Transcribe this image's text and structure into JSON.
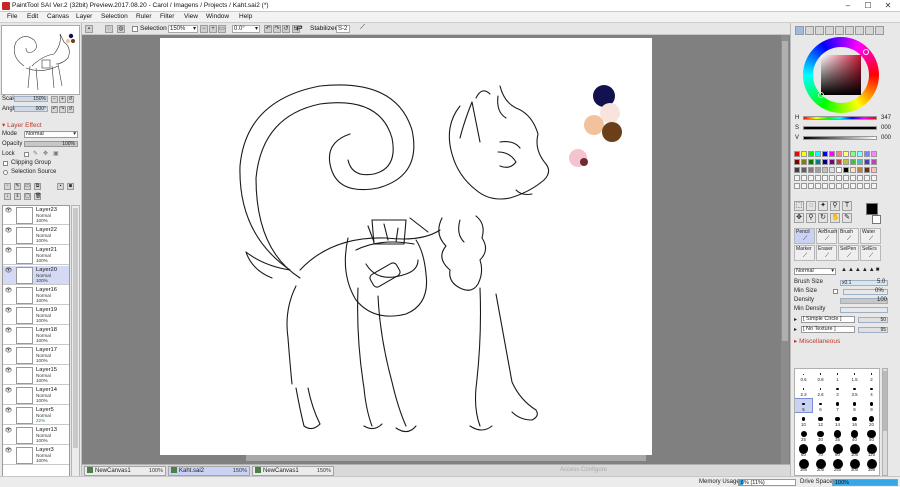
{
  "window": {
    "title": "PaintTool SAI Ver.2 (32bit) Preview.2017.08.20 - Carol / Imagens / Projects / Kaht.sai2 (*)"
  },
  "menu": [
    "File",
    "Edit",
    "Canvas",
    "Layer",
    "Selection",
    "Ruler",
    "Filter",
    "View",
    "Window",
    "Help"
  ],
  "toolbar": {
    "selection_label": "Selection",
    "zoom": "150%",
    "angle": "0.0°",
    "stabilizer_label": "Stabilizer",
    "stabilizer_value": "S-2"
  },
  "navigator": {
    "scale_label": "Scale",
    "scale_value": "150%",
    "angle_label": "Angle",
    "angle_value": "000°"
  },
  "layer_effect": {
    "title": "Layer Effect",
    "mode_label": "Mode",
    "mode_value": "Normal",
    "opacity_label": "Opacity",
    "opacity_value": "100%",
    "lock_label": "Lock",
    "clipping_group": "Clipping Group",
    "selection_source": "Selection Source"
  },
  "layers": [
    {
      "name": "Layer23",
      "mode": "Normal",
      "opacity": "100%",
      "selected": false
    },
    {
      "name": "Layer22",
      "mode": "Normal",
      "opacity": "100%",
      "selected": false
    },
    {
      "name": "Layer21",
      "mode": "Normal",
      "opacity": "100%",
      "selected": false
    },
    {
      "name": "Layer20",
      "mode": "Normal",
      "opacity": "100%",
      "selected": true
    },
    {
      "name": "Layer16",
      "mode": "Normal",
      "opacity": "100%",
      "selected": false
    },
    {
      "name": "Layer19",
      "mode": "Normal",
      "opacity": "100%",
      "selected": false
    },
    {
      "name": "Layer18",
      "mode": "Normal",
      "opacity": "100%",
      "selected": false
    },
    {
      "name": "Layer17",
      "mode": "Normal",
      "opacity": "100%",
      "selected": false
    },
    {
      "name": "Layer15",
      "mode": "Normal",
      "opacity": "100%",
      "selected": false
    },
    {
      "name": "Layer14",
      "mode": "Normal",
      "opacity": "100%",
      "selected": false
    },
    {
      "name": "Layer5",
      "mode": "Normal",
      "opacity": "22%",
      "selected": false
    },
    {
      "name": "Layer13",
      "mode": "Normal",
      "opacity": "100%",
      "selected": false
    },
    {
      "name": "Layer3",
      "mode": "Normal",
      "opacity": "100%",
      "selected": false
    }
  ],
  "canvas_tabs": [
    {
      "name": "NewCanvas1",
      "zoom": "100%",
      "active": false
    },
    {
      "name": "Kaht.sai2",
      "zoom": "150%",
      "active": true
    },
    {
      "name": "NewCanvas1",
      "zoom": "150%",
      "active": false
    }
  ],
  "status": {
    "memory_label": "Memory Usage",
    "memory_value": "8% (11%)",
    "memory_fraction": 0.08,
    "drive_label": "Drive Space",
    "drive_value": "100%",
    "drive_fraction": 1.0,
    "watermark": "Access Configure"
  },
  "color": {
    "h_label": "H",
    "h_value": "347",
    "s_label": "S",
    "s_value": "000",
    "v_label": "V",
    "v_value": "000",
    "primary": "#000000",
    "secondary": "#ffffff",
    "palette_dots": [
      "#13124f",
      "#f7e4dc",
      "#f2c29c",
      "#6b3f19",
      "#f4c3cd",
      "#6e2a32"
    ]
  },
  "tools": {
    "brushes": [
      "Pencil",
      "AirBrush",
      "Brush",
      "Water",
      "Marker",
      "Eraser",
      "SelPen",
      "SelErs"
    ],
    "blend_mode": "Normal",
    "brush_size_label": "Brush Size",
    "brush_size_mult": "x0.1",
    "brush_size_value": "5.0",
    "min_size_label": "Min Size",
    "min_size_value": "0%",
    "density_label": "Density",
    "density_value": "100",
    "min_density_label": "Min Density",
    "shape": "[ Simple Circle ]",
    "shape_value": "50",
    "texture": "[ No Texture ]",
    "texture_value": "95",
    "misc_label": "Miscellaneous",
    "sizes": [
      "0.6",
      "0.8",
      "1",
      "1.5",
      "2",
      "2.3",
      "2.6",
      "3",
      "3.5",
      "4",
      "5",
      "6",
      "7",
      "8",
      "9",
      "10",
      "12",
      "14",
      "16",
      "20",
      "25",
      "30",
      "35",
      "40",
      "50",
      "60",
      "70",
      "80",
      "100",
      "120",
      "160",
      "200",
      "250",
      "300",
      "350"
    ],
    "active_size": "5"
  }
}
